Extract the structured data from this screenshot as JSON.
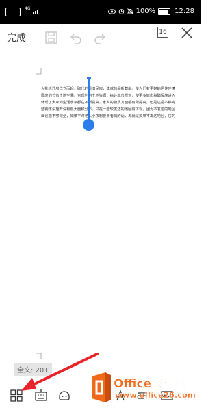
{
  "status_bar": {
    "network": "4G",
    "battery_text": "100%",
    "time": "12:28"
  },
  "toolbar": {
    "done_label": "完成",
    "page_count": "16"
  },
  "document": {
    "lines": [
      "大批拆迁房伫立而起，取代的是旧民房，建成的是新截房。使人们有更好的居住环境",
      "隔废的节省土地空间，合理利用土地资源，搞好城市规划，使更多城市基础设施进入",
      "体现了大家的生活水平都在不断提高，家乡的物质方面都有所提高，但是还是不够完",
      "些铜炼设施开没有很大面积分布，只在一些较发达的地区有体现。因为不发达的地区",
      "础设施不够完全，如果平时老人小孩想要去看病的话，再就是如果不发达地区，它的"
    ]
  },
  "word_count": "全文: 201",
  "watermark": {
    "brand": "Office教程网",
    "url": "www.office26.com",
    "colors": {
      "orange": "#f06a1c",
      "white": "#ffffff"
    }
  },
  "accent_color": "#2b7de9",
  "arrow_color": "#e8232a"
}
